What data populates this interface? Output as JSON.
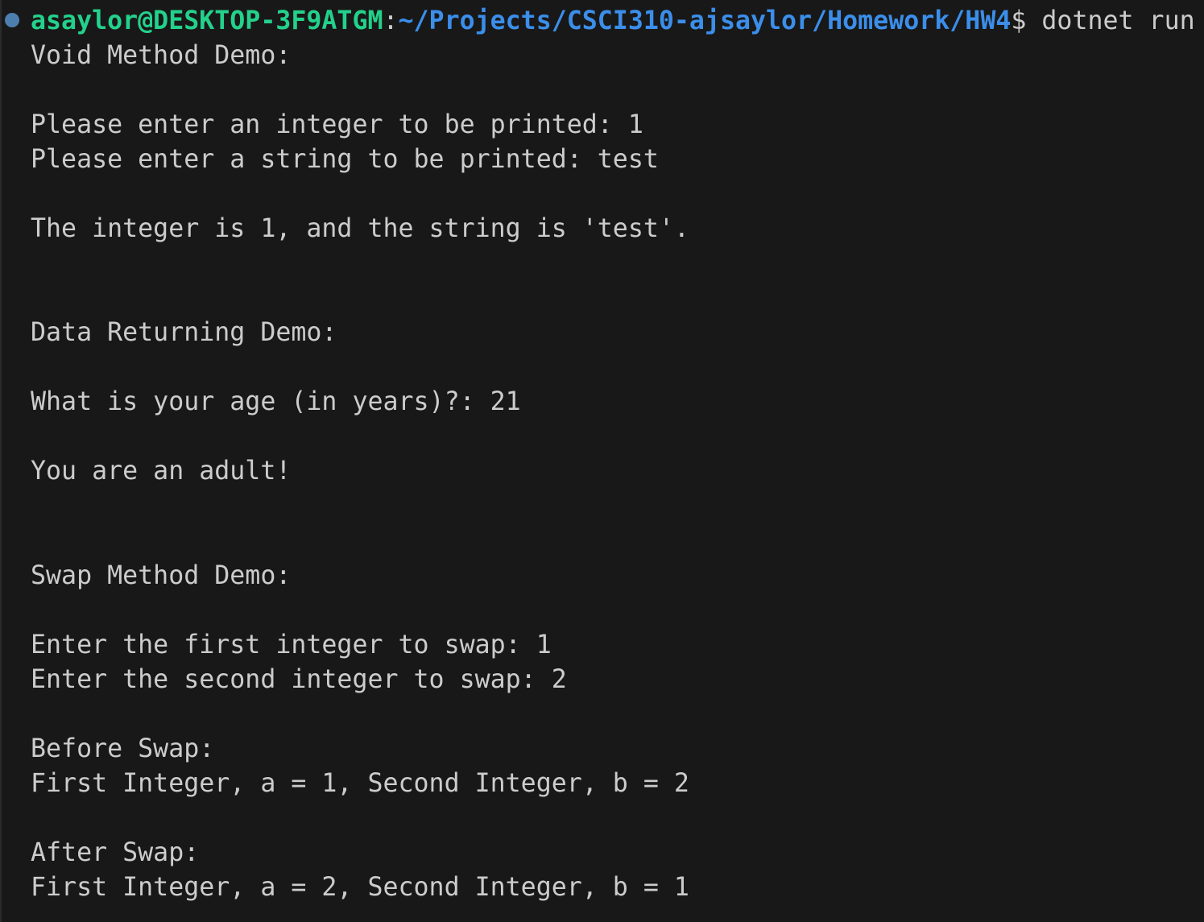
{
  "prompt": {
    "user_host": "asaylor@DESKTOP-3F9ATGM",
    "separator": ":",
    "path": "~/Projects/CSCI310-ajsaylor/Homework/HW4",
    "dollar": "$",
    "command": " dotnet run"
  },
  "output": {
    "void_header": "Void Method Demo:",
    "void_prompt_int": "Please enter an integer to be printed: 1",
    "void_prompt_str": "Please enter a string to be printed: test",
    "void_result": "The integer is 1, and the string is 'test'.",
    "data_header": "Data Returning Demo:",
    "data_prompt_age": "What is your age (in years)?: 21",
    "data_result": "You are an adult!",
    "swap_header": "Swap Method Demo:",
    "swap_prompt_first": "Enter the first integer to swap: 1",
    "swap_prompt_second": "Enter the second integer to swap: 2",
    "swap_before_label": "Before Swap:",
    "swap_before_values": "First Integer, a = 1, Second Integer, b = 2",
    "swap_after_label": "After Swap:",
    "swap_after_values": "First Integer, a = 2, Second Integer, b = 1"
  },
  "colors": {
    "background": "#181818",
    "text": "#cccccc",
    "user_host": "#23d18b",
    "path": "#3b8eea",
    "decoration": "#4d7fae"
  }
}
